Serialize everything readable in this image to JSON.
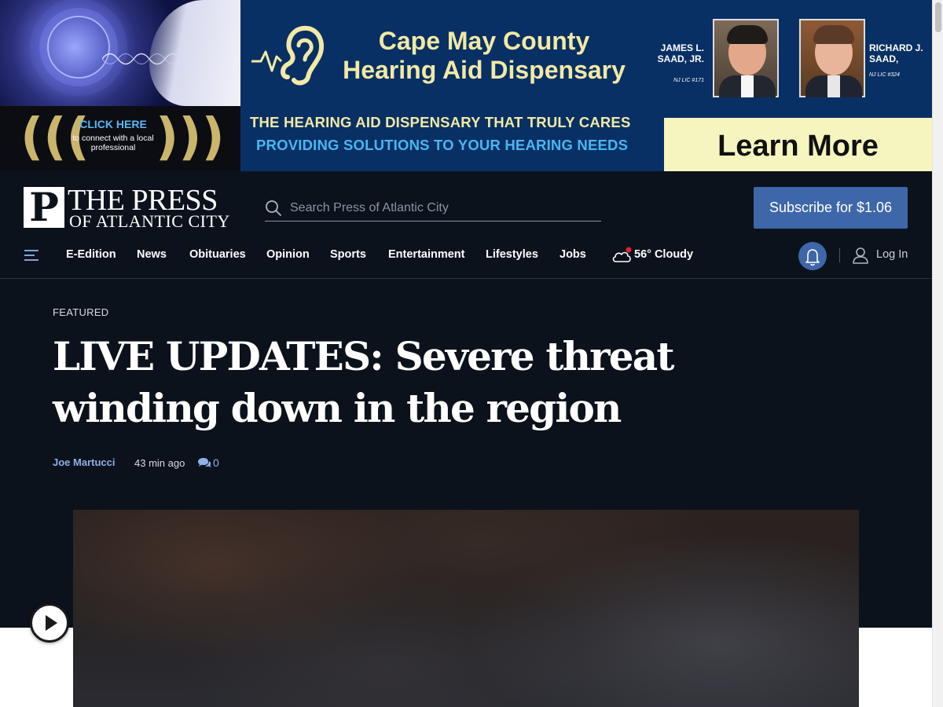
{
  "ad": {
    "click_title": "CLICK HERE",
    "click_sub": "to connect with a local professional",
    "title_line1": "Cape May County",
    "title_line2": "Hearing Aid Dispensary",
    "person1_name": "JAMES L. SAAD, JR.",
    "person1_lic": "NJ LIC #171",
    "person2_name": "RICHARD J. SAAD,",
    "person2_lic": "NJ LIC #324",
    "tagline1": "THE HEARING AID DISPENSARY THAT TRULY CARES",
    "tagline2": "PROVIDING SOLUTIONS TO YOUR HEARING NEEDS",
    "cta": "Learn More",
    "colors": {
      "background": "#083064",
      "accent_yellow": "#f1e9a5",
      "accent_blue": "#49b6f0",
      "cta_bg": "#f6f5bf"
    }
  },
  "header": {
    "logo_mark": "P",
    "logo_line1": "THE PRESS",
    "logo_line2": "OF ATLANTIC CITY",
    "search_placeholder": "Search Press of Atlantic City",
    "subscribe_label": "Subscribe for $1.06",
    "colors": {
      "background": "#0c121c",
      "accent": "#3e67a9"
    }
  },
  "nav": {
    "items": [
      "E-Edition",
      "News",
      "Obituaries",
      "Opinion",
      "Sports",
      "Entertainment",
      "Lifestyles",
      "Jobs"
    ],
    "weather": "56° Cloudy",
    "login_label": "Log In",
    "icons": [
      "menu-icon",
      "weather-cloud-icon",
      "bell-icon",
      "user-icon"
    ]
  },
  "article": {
    "kicker": "FEATURED",
    "headline": "LIVE UPDATES: Severe threat winding down in the region",
    "author": "Joe Martucci",
    "time": "43 min ago",
    "comments": "0"
  }
}
